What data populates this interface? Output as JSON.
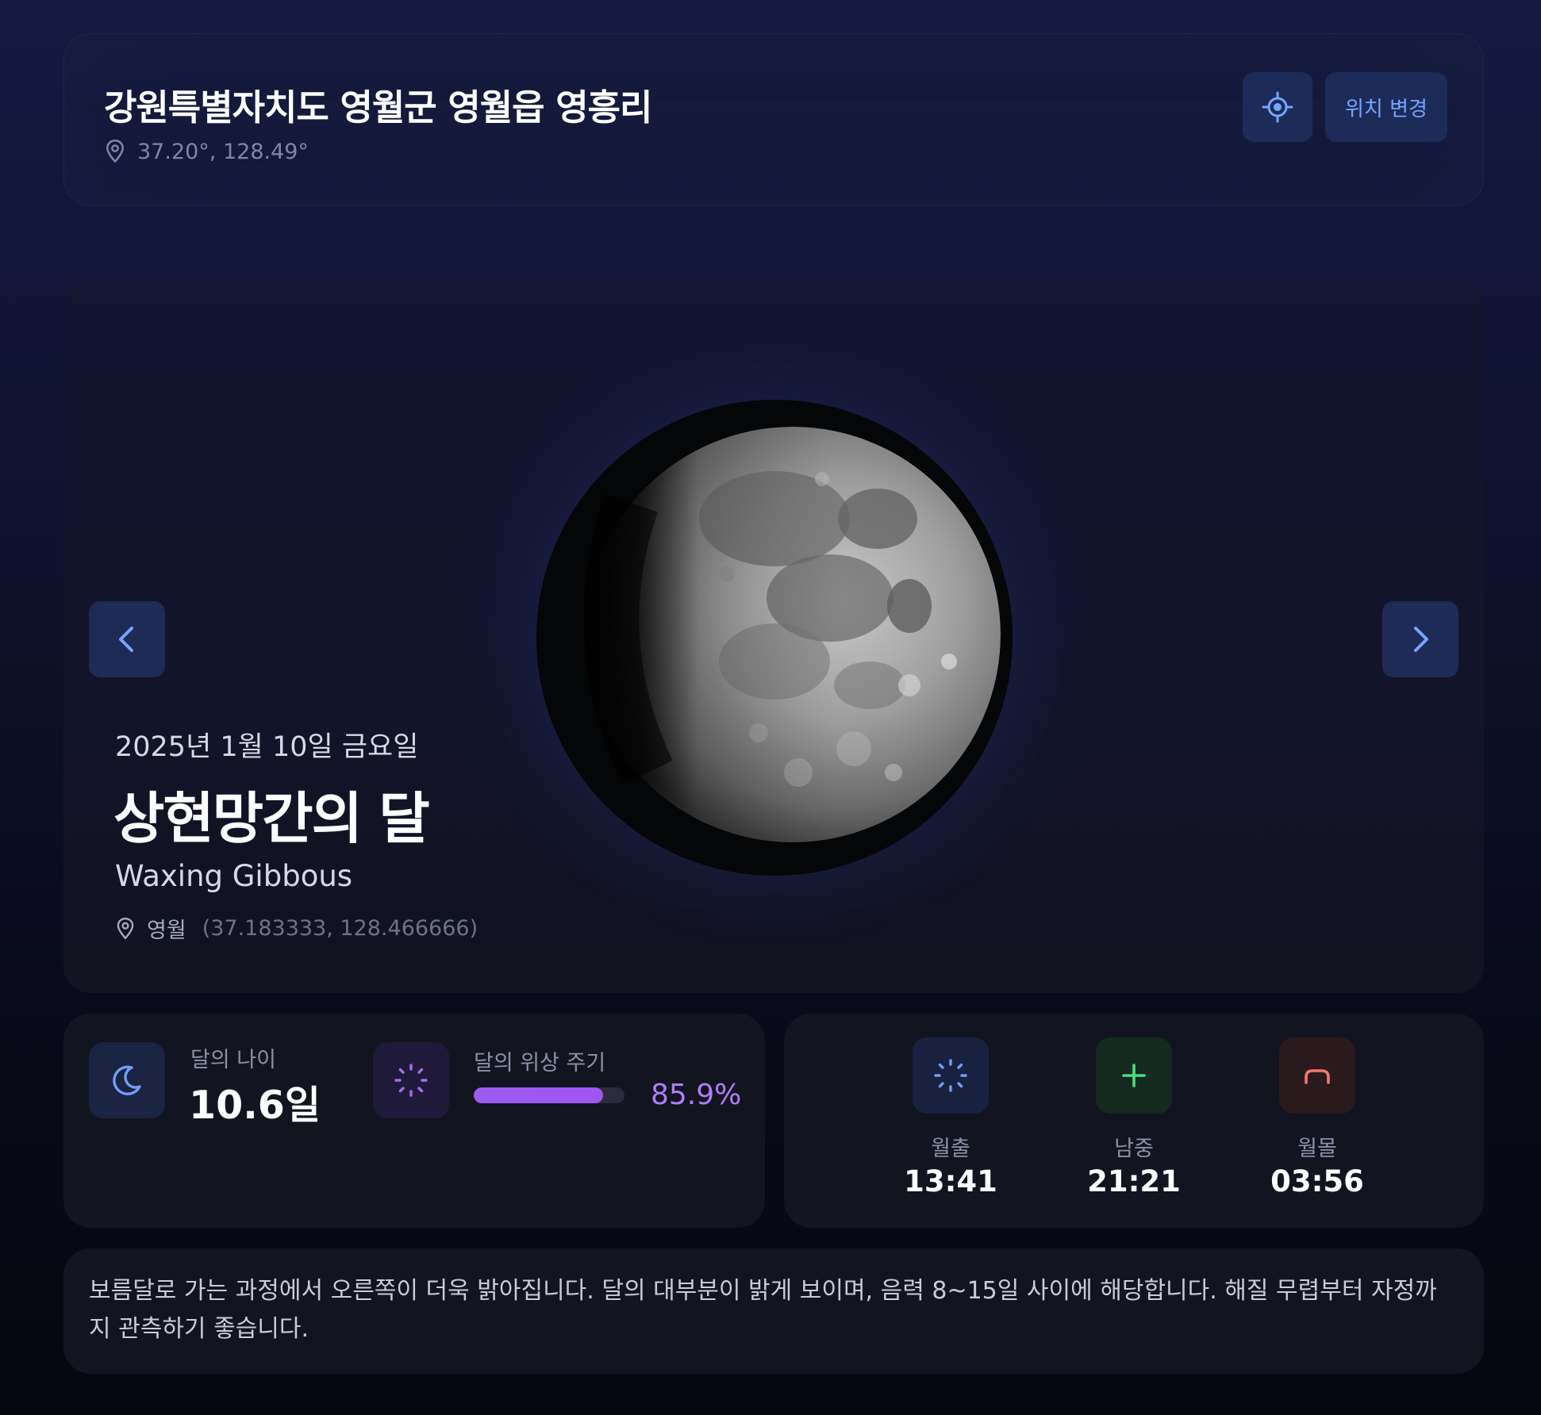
{
  "header": {
    "location_name": "강원특별자치도 영월군 영월읍 영흥리",
    "coordinates": "37.20°, 128.49°",
    "locate_icon": "crosshair-icon",
    "change_location_label": "위치 변경"
  },
  "hero": {
    "date": "2025년 1월 10일 금요일",
    "phase_name_ko": "상현망간의 달",
    "phase_name_en": "Waxing Gibbous",
    "place": "영월",
    "place_coords": "(37.183333, 128.466666)",
    "prev_icon": "chevron-left-icon",
    "next_icon": "chevron-right-icon"
  },
  "stats": {
    "age_label": "달의 나이",
    "age_value": "10.6일",
    "cycle_label": "달의 위상 주기",
    "cycle_value": "85.9%",
    "cycle_fraction": 0.859
  },
  "times": {
    "rise_label": "월출",
    "rise_value": "13:41",
    "transit_label": "남중",
    "transit_value": "21:21",
    "set_label": "월몰",
    "set_value": "03:56"
  },
  "description": "보름달로 가는 과정에서 오른쪽이 더욱 밝아집니다. 달의 대부분이 밝게 보이며, 음력 8~15일 사이에 해당합니다. 해질 무렵부터 자정까지 관측하기 좋습니다.",
  "colors": {
    "accent_blue": "#74a6ff",
    "accent_purple": "#b07dff",
    "transit_green": "#4ade80",
    "set_red": "#f07a6e"
  }
}
